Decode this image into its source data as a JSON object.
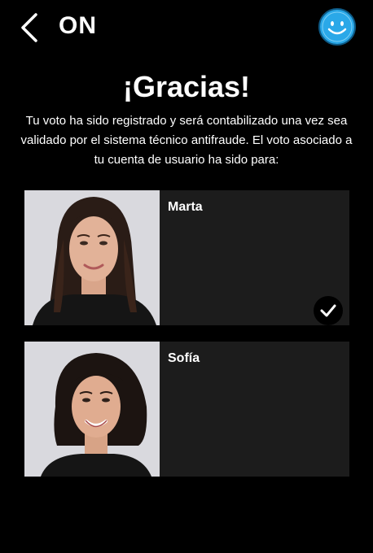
{
  "header": {
    "brand": "ON"
  },
  "confirmation": {
    "title": "¡Gracias!",
    "message": "Tu voto ha sido registrado y será contabilizado una vez sea validado por el sistema técnico antifraude. El voto asociado a tu cuenta de usuario ha sido para:"
  },
  "candidates": [
    {
      "name": "Marta",
      "selected": true
    },
    {
      "name": "Sofía",
      "selected": false
    }
  ],
  "colors": {
    "background": "#000000",
    "card": "#1c1c1c",
    "accent": "#2aa8e8"
  }
}
